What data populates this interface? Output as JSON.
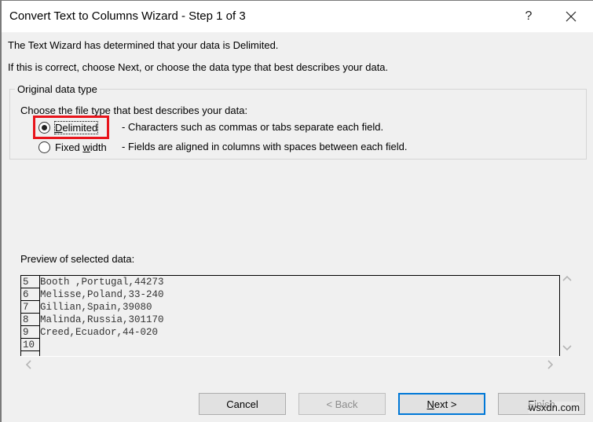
{
  "window": {
    "title": "Convert Text to Columns Wizard - Step 1 of 3",
    "help_label": "?",
    "close_icon": "close-icon"
  },
  "messages": {
    "line1": "The Text Wizard has determined that your data is Delimited.",
    "line2": "If this is correct, choose Next, or choose the data type that best describes your data."
  },
  "original_data_type": {
    "legend": "Original data type",
    "prompt": "Choose the file type that best describes your data:",
    "options": [
      {
        "label_access": "D",
        "label_rest": "elimited",
        "description": "- Characters such as commas or tabs separate each field.",
        "checked": true
      },
      {
        "label_pre": "Fixed ",
        "label_access": "w",
        "label_rest": "idth",
        "description": "- Fields are aligned in columns with spaces between each field.",
        "checked": false
      }
    ],
    "highlight_color": "#e8141b"
  },
  "preview": {
    "label": "Preview of selected data:",
    "rows": [
      {
        "num": "5",
        "text": "Booth ,Portugal,44273"
      },
      {
        "num": "6",
        "text": "Melisse,Poland,33-240"
      },
      {
        "num": "7",
        "text": "Gillian,Spain,39080"
      },
      {
        "num": "8",
        "text": "Malinda,Russia,301170"
      },
      {
        "num": "9",
        "text": "Creed,Ecuador,44-020"
      },
      {
        "num": "10",
        "text": ""
      }
    ],
    "scroll_icons": {
      "up": "^",
      "down": "v",
      "left": "<",
      "right": ">"
    }
  },
  "buttons": {
    "cancel": "Cancel",
    "back": "< Back",
    "next_access": "N",
    "next_rest": "ext >",
    "finish_access": "F",
    "finish_rest": "inish"
  },
  "watermark": "wsxdn.com",
  "colors": {
    "default_button_border": "#0078d7",
    "background": "#f0f0f0"
  }
}
